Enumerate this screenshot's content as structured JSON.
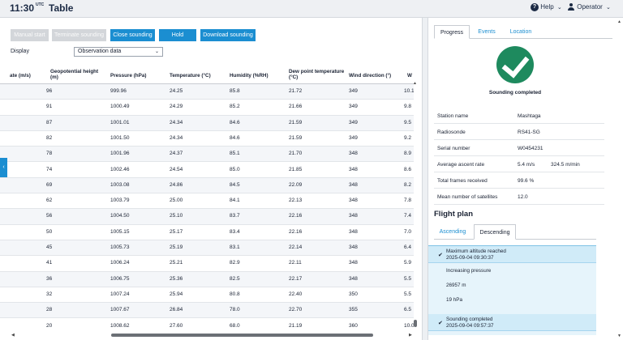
{
  "header": {
    "time": "11:30",
    "timezone": "UTC",
    "title": "Table",
    "help": "Help",
    "operator": "Operator"
  },
  "toolbar": {
    "manual_start": "Manual start",
    "terminate": "Terminate sounding",
    "close": "Close sounding",
    "hold": "Hold",
    "download": "Download sounding"
  },
  "display": {
    "label": "Display",
    "value": "Observation data"
  },
  "table": {
    "columns": [
      {
        "label": "ate (m/s)"
      },
      {
        "label": "Geopotential height (m)"
      },
      {
        "label": "Pressure (hPa)"
      },
      {
        "label": "Temperature (°C)"
      },
      {
        "label": "Humidity (%RH)"
      },
      {
        "label": "Dew point temperature (°C)"
      },
      {
        "label": "Wind direction (°)"
      },
      {
        "label": "W"
      }
    ],
    "rows": [
      [
        "96",
        "999.96",
        "24.25",
        "85.8",
        "21.72",
        "349",
        "10.1"
      ],
      [
        "91",
        "1000.49",
        "24.29",
        "85.2",
        "21.66",
        "349",
        "9.8"
      ],
      [
        "87",
        "1001.01",
        "24.34",
        "84.6",
        "21.59",
        "349",
        "9.5"
      ],
      [
        "82",
        "1001.50",
        "24.34",
        "84.6",
        "21.59",
        "349",
        "9.2"
      ],
      [
        "78",
        "1001.96",
        "24.37",
        "85.1",
        "21.70",
        "348",
        "8.9"
      ],
      [
        "74",
        "1002.46",
        "24.54",
        "85.0",
        "21.85",
        "348",
        "8.6"
      ],
      [
        "69",
        "1003.08",
        "24.86",
        "84.5",
        "22.09",
        "348",
        "8.2"
      ],
      [
        "62",
        "1003.79",
        "25.00",
        "84.1",
        "22.13",
        "348",
        "7.8"
      ],
      [
        "56",
        "1004.50",
        "25.10",
        "83.7",
        "22.16",
        "348",
        "7.4"
      ],
      [
        "50",
        "1005.15",
        "25.17",
        "83.4",
        "22.16",
        "348",
        "7.0"
      ],
      [
        "45",
        "1005.73",
        "25.19",
        "83.1",
        "22.14",
        "348",
        "6.4"
      ],
      [
        "41",
        "1006.24",
        "25.21",
        "82.9",
        "22.11",
        "348",
        "5.9"
      ],
      [
        "36",
        "1006.75",
        "25.36",
        "82.5",
        "22.17",
        "348",
        "5.5"
      ],
      [
        "32",
        "1007.24",
        "25.94",
        "80.8",
        "22.40",
        "350",
        "5.5"
      ],
      [
        "28",
        "1007.67",
        "26.84",
        "78.0",
        "22.70",
        "355",
        "6.5"
      ],
      [
        "20",
        "1008.62",
        "27.60",
        "68.0",
        "21.19",
        "360",
        "10.0"
      ]
    ]
  },
  "panel": {
    "tabs": [
      "Progress",
      "Events",
      "Location"
    ],
    "status": "Sounding completed",
    "info": [
      {
        "label": "Station name",
        "value": "Mashtaga",
        "value2": ""
      },
      {
        "label": "Radiosonde",
        "value": "RS41-SG",
        "value2": ""
      },
      {
        "label": "Serial number",
        "value": "W0454231",
        "value2": ""
      },
      {
        "label": "Average ascent rate",
        "value": "5.4 m/s",
        "value2": "324.5 m/min"
      },
      {
        "label": "Total frames received",
        "value": "99.6 %",
        "value2": ""
      },
      {
        "label": "Mean number of satellites",
        "value": "12.0",
        "value2": ""
      }
    ],
    "flight_plan": {
      "title": "Flight plan",
      "tabs": [
        "Ascending",
        "Descending"
      ],
      "events": [
        {
          "title": "Maximum altitude reached",
          "time": "2025-09-04 09:30:37"
        },
        {
          "title": "Increasing pressure",
          "time": ""
        },
        {
          "title": "26957 m",
          "time": ""
        },
        {
          "title": "19 hPa",
          "time": ""
        },
        {
          "title": "Sounding completed",
          "time": "2025-09-04 09:57:37"
        }
      ]
    }
  },
  "colors": {
    "accent": "#1b8ed1",
    "success": "#1e8a5e"
  }
}
